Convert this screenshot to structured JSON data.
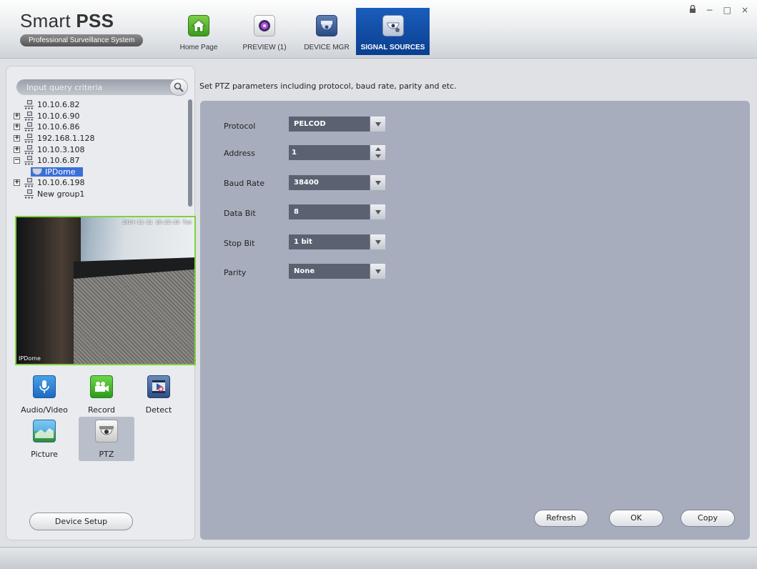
{
  "app": {
    "title_light": "Smart ",
    "title_bold": "PSS",
    "subtitle": "Professional Surveillance System"
  },
  "window_controls": {
    "lock": "🔒",
    "minimize": "−",
    "maximize": "□",
    "close": "×"
  },
  "nav": {
    "tabs": [
      {
        "label": "Home Page",
        "icon": "home-icon",
        "active": false
      },
      {
        "label": "PREVIEW (1)",
        "icon": "preview-camera-icon",
        "active": false
      },
      {
        "label": "DEVICE MGR",
        "icon": "device-dome-icon",
        "active": false
      },
      {
        "label": "SIGNAL SOURCES",
        "icon": "signal-dome-gear-icon",
        "active": true
      }
    ]
  },
  "search": {
    "placeholder": "Input query criteria",
    "icon": "search-icon"
  },
  "tree": {
    "items": [
      {
        "label": "10.10.6.82",
        "expander": ""
      },
      {
        "label": "10.10.6.90",
        "expander": "+"
      },
      {
        "label": "10.10.6.86",
        "expander": "+"
      },
      {
        "label": "192.168.1.128",
        "expander": "+"
      },
      {
        "label": "10.10.3.108",
        "expander": "+"
      },
      {
        "label": "10.10.6.87",
        "expander": "−"
      },
      {
        "label": "IPDome",
        "child": true,
        "selected": true
      },
      {
        "label": "10.10.6.198",
        "expander": "+"
      },
      {
        "label": "New group1",
        "expander": ""
      }
    ]
  },
  "video": {
    "timestamp": "2014-11-11 10:22:33 Tue",
    "channel_name": "IPDome"
  },
  "functions": {
    "audio_video": "Audio/Video",
    "record": "Record",
    "detect": "Detect",
    "picture": "Picture",
    "ptz": "PTZ"
  },
  "device_setup_label": "Device Setup",
  "description": "Set PTZ parameters including protocol, baud rate, parity and etc.",
  "form": {
    "protocol": {
      "label": "Protocol",
      "value": "PELCOD"
    },
    "address": {
      "label": "Address",
      "value": "1"
    },
    "baud_rate": {
      "label": "Baud Rate",
      "value": "38400"
    },
    "data_bit": {
      "label": "Data Bit",
      "value": "8"
    },
    "stop_bit": {
      "label": "Stop Bit",
      "value": "1 bit"
    },
    "parity": {
      "label": "Parity",
      "value": "None"
    }
  },
  "buttons": {
    "refresh": "Refresh",
    "ok": "OK",
    "copy": "Copy"
  },
  "colors": {
    "accent": "#0b3f8f",
    "panel": "#a7adbd",
    "select_bg": "#5a6271",
    "video_border": "#7fd13d",
    "tree_selection": "#3a6fd8"
  }
}
